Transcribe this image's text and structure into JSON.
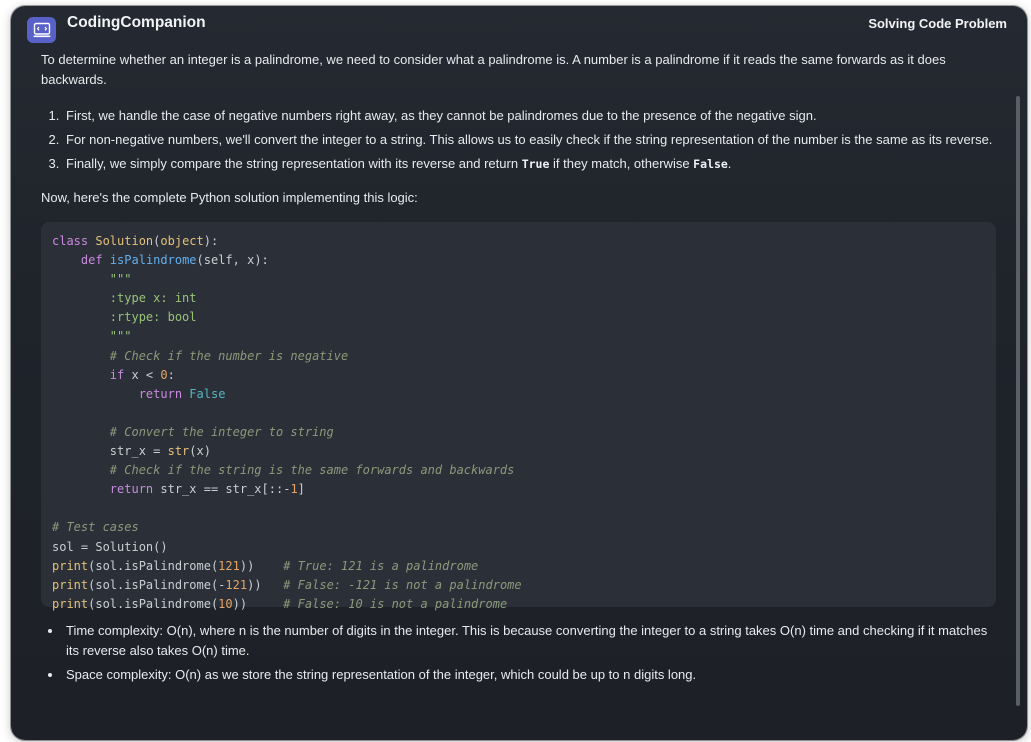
{
  "app": {
    "title": "CodingCompanion",
    "icon": "terminal-icon",
    "context_title": "Solving Code Problem"
  },
  "message": {
    "intro": "To determine whether an integer is a palindrome, we need to consider what a palindrome is. A number is a palindrome if it reads the same forwards as it does backwards.",
    "steps": [
      "First, we handle the case of negative numbers right away, as they cannot be palindromes due to the presence of the negative sign.",
      "For non-negative numbers, we'll convert the integer to a string. This allows us to easily check if the string representation of the number is the same as its reverse."
    ],
    "step3": {
      "before": "Finally, we simply compare the string representation with its reverse and return ",
      "code_true": "True",
      "middle": " if they match, otherwise ",
      "code_false": "False",
      "after": "."
    },
    "lead": "Now, here's the complete Python solution implementing this logic:",
    "notes": [
      "Time complexity: O(n), where n is the number of digits in the integer. This is because converting the integer to a string takes O(n) time and checking if it matches its reverse also takes O(n) time.",
      "Space complexity: O(n) as we store the string representation of the integer, which could be up to n digits long."
    ]
  },
  "code": {
    "language": "python",
    "lines": [
      "class Solution(object):",
      "    def isPalindrome(self, x):",
      "        \"\"\"",
      "        :type x: int",
      "        :rtype: bool",
      "        \"\"\"",
      "        # Check if the number is negative",
      "        if x < 0:",
      "            return False",
      "",
      "        # Convert the integer to string",
      "        str_x = str(x)",
      "        # Check if the string is the same forwards and backwards",
      "        return str_x == str_x[::-1]",
      "",
      "# Test cases",
      "sol = Solution()",
      "print(sol.isPalindrome(121))    # True: 121 is a palindrome",
      "print(sol.isPalindrome(-121))   # False: -121 is not a palindrome",
      "print(sol.isPalindrome(10))     # False: 10 is not a palindrome"
    ]
  },
  "colors": {
    "background": "#1f232a",
    "code_background": "#2b2f37",
    "icon_background": "#5861c8"
  }
}
